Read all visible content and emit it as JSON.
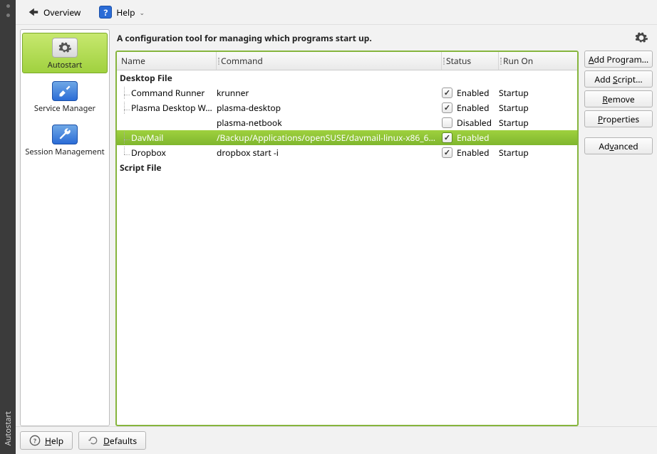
{
  "vbar": {
    "label": "Autostart"
  },
  "toolbar": {
    "overview_label": "Overview",
    "help_label": "Help"
  },
  "sidebar": {
    "items": [
      {
        "label": "Autostart"
      },
      {
        "label": "Service Manager"
      },
      {
        "label": "Session Management"
      }
    ]
  },
  "main": {
    "title": "A configuration tool for managing which programs start up."
  },
  "columns": {
    "name": "Name",
    "command": "Command",
    "status": "Status",
    "runon": "Run On"
  },
  "groups": {
    "desktop": "Desktop File",
    "script": "Script File"
  },
  "rows": [
    {
      "name": "Command Runner",
      "command": "krunner",
      "checked": true,
      "status": "Enabled",
      "runon": "Startup",
      "selected": false,
      "last": false
    },
    {
      "name": "Plasma Desktop W…",
      "command": "plasma-desktop",
      "checked": true,
      "status": "Enabled",
      "runon": "Startup",
      "selected": false,
      "last": false
    },
    {
      "name": "",
      "command": "plasma-netbook",
      "checked": false,
      "status": "Disabled",
      "runon": "Startup",
      "selected": false,
      "last": false
    },
    {
      "name": "DavMail",
      "command": "/Backup/Applications/openSUSE/davmail-linux-x86_6…",
      "checked": true,
      "status": "Enabled",
      "runon": "",
      "selected": true,
      "last": false
    },
    {
      "name": "Dropbox",
      "command": "dropbox start -i",
      "checked": true,
      "status": "Enabled",
      "runon": "Startup",
      "selected": false,
      "last": true
    }
  ],
  "actions": {
    "add_program": "Add Program…",
    "add_script": "Add Script…",
    "remove": "Remove",
    "properties": "Properties",
    "advanced": "Advanced"
  },
  "footer": {
    "help": "Help",
    "defaults": "Defaults"
  }
}
